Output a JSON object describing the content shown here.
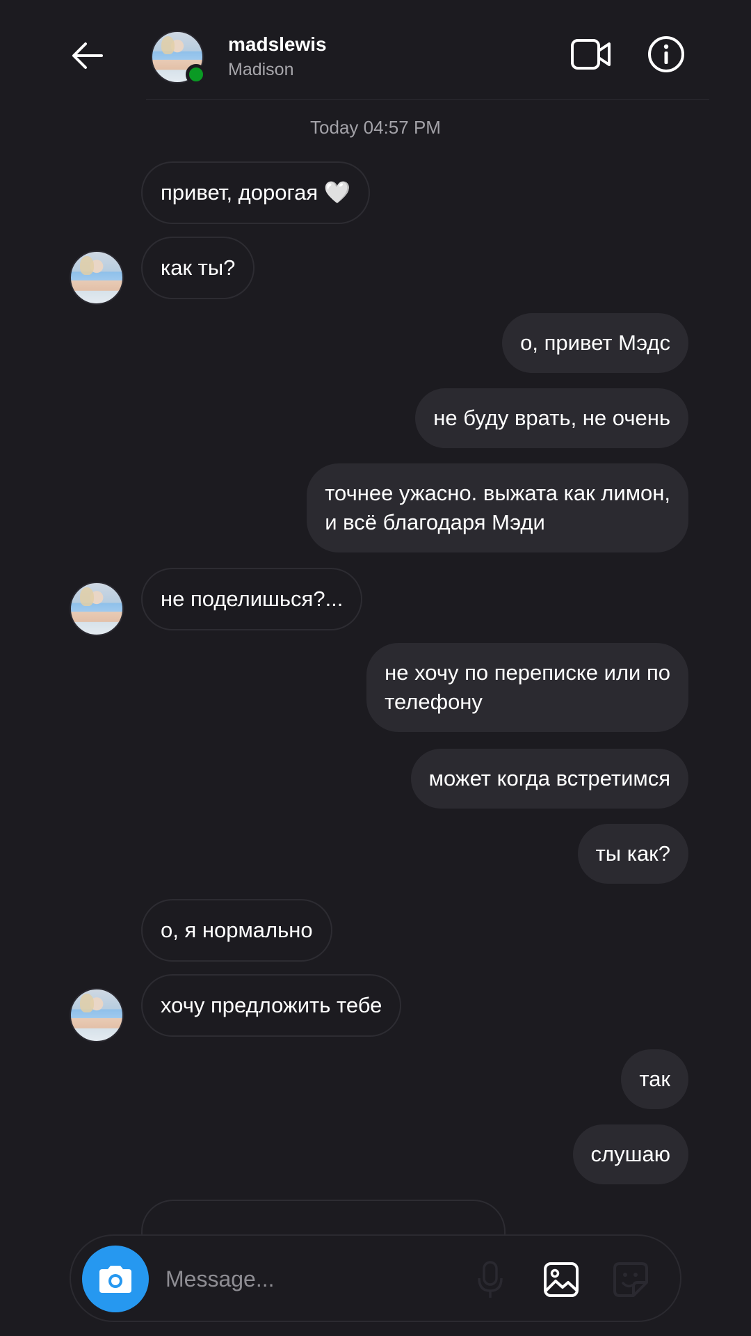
{
  "header": {
    "username": "madslewis",
    "display_name": "Madison"
  },
  "timestamp": "Today 04:57 PM",
  "messages": [
    {
      "side": "in",
      "text": "привет, дорогая 🤍",
      "avatar": false
    },
    {
      "side": "in",
      "text": "как ты?",
      "avatar": true
    },
    {
      "side": "out",
      "text": "о, привет Мэдс"
    },
    {
      "side": "out",
      "text": "не буду врать, не очень"
    },
    {
      "side": "out",
      "text": "точнее ужасно. выжата как лимон,\nи всё благодаря Мэди"
    },
    {
      "side": "in",
      "text": "не поделишься?...",
      "avatar": true
    },
    {
      "side": "out",
      "text": "не хочу по переписке или по\nтелефону"
    },
    {
      "side": "out",
      "text": "может когда встретимся"
    },
    {
      "side": "out",
      "text": "ты как?"
    },
    {
      "side": "in",
      "text": "о, я нормально",
      "avatar": false
    },
    {
      "side": "in",
      "text": "хочу предложить тебе",
      "avatar": true
    },
    {
      "side": "out",
      "text": "так"
    },
    {
      "side": "out",
      "text": "слушаю"
    }
  ],
  "composer": {
    "placeholder": "Message..."
  },
  "icons": {
    "back": "arrow-left-icon",
    "video": "video-camera-icon",
    "info": "info-icon",
    "camera": "camera-icon",
    "mic": "microphone-icon",
    "gallery": "gallery-icon",
    "sticker": "sticker-icon"
  },
  "colors": {
    "background": "#1c1b20",
    "outgoing_bubble": "#2b2a30",
    "camera_button": "#2698f0",
    "online_status": "#0a9a24"
  }
}
